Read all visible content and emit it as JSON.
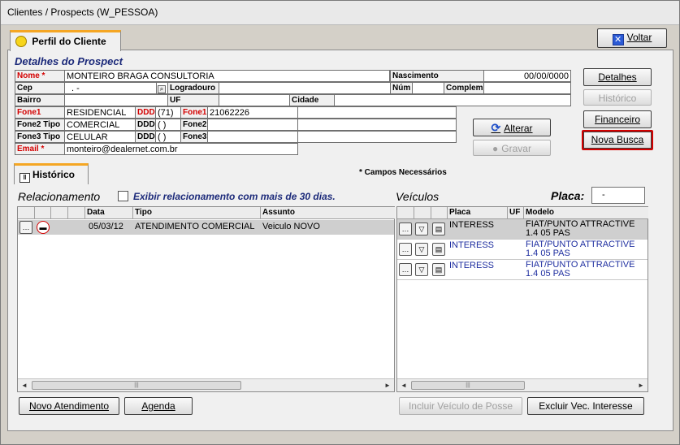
{
  "window": {
    "title": "Clientes / Prospects (W_PESSOA)"
  },
  "tabs": {
    "profile": "Perfil do Cliente",
    "history": "Histórico"
  },
  "buttons": {
    "voltar": "Voltar",
    "detalhes": "Detalhes",
    "historico": "Histórico",
    "financeiro": "Financeiro",
    "nova_busca": "Nova Busca",
    "alterar": "Alterar",
    "gravar": "Gravar",
    "novo_atendimento": "Novo Atendimento",
    "agenda": "Agenda",
    "incluir_veiculo": "Incluir Veículo de Posse",
    "excluir_vec": "Excluir Vec. Interesse"
  },
  "details": {
    "heading": "Detalhes do Prospect",
    "labels": {
      "nome": "Nome *",
      "nascimento": "Nascimento",
      "cep": "Cep",
      "logradouro": "Logradouro",
      "num": "Núm",
      "complem": "Complem.",
      "bairro": "Bairro",
      "uf": "UF",
      "cidade": "Cidade",
      "fone1_tipo": "Fone1 Tipo*",
      "ddd": "DDD",
      "fone1": "Fone1",
      "fone2_tipo": "Fone2 Tipo",
      "fone2": "Fone2",
      "fone3_tipo": "Fone3 Tipo",
      "fone3": "Fone3",
      "email": "Email *"
    },
    "values": {
      "nome": "MONTEIRO BRAGA CONSULTORIA",
      "nascimento": "00/00/0000",
      "cep": ". -",
      "fone1_tipo": "RESIDENCIAL",
      "ddd1": "(71)",
      "fone1": "21062226",
      "fone2_tipo": "COMERCIAL",
      "ddd2": "( )",
      "fone3_tipo": "CELULAR",
      "ddd3": "( )",
      "email": "monteiro@dealernet.com.br"
    }
  },
  "note": "* Campos Necessários",
  "relacionamento": {
    "title": "Relacionamento",
    "checkbox_label": "Exibir relacionamento com mais de 30 dias.",
    "columns": [
      "Data",
      "Tipo",
      "Assunto"
    ],
    "rows": [
      {
        "data": "05/03/12",
        "tipo": "ATENDIMENTO COMERCIAL",
        "assunto": "Veiculo NOVO"
      }
    ]
  },
  "veiculos": {
    "title": "Veículos",
    "placa_label": "Placa:",
    "placa_value": "-",
    "columns": [
      "Placa",
      "UF",
      "Modelo"
    ],
    "rows": [
      {
        "placa": "INTERESS",
        "uf": "",
        "modelo": "FIAT/PUNTO ATTRACTIVE 1.4 05 PAS"
      },
      {
        "placa": "INTERESS",
        "uf": "",
        "modelo": "FIAT/PUNTO ATTRACTIVE 1.4 05 PAS"
      },
      {
        "placa": "INTERESS",
        "uf": "",
        "modelo": "FIAT/PUNTO ATTRACTIVE 1.4 05 PAS"
      }
    ]
  },
  "colors": {
    "accent": "#1c2a7a",
    "required": "#d40000",
    "selected_row": "#cfcfcf",
    "link_blue": "#1f2fa0"
  }
}
